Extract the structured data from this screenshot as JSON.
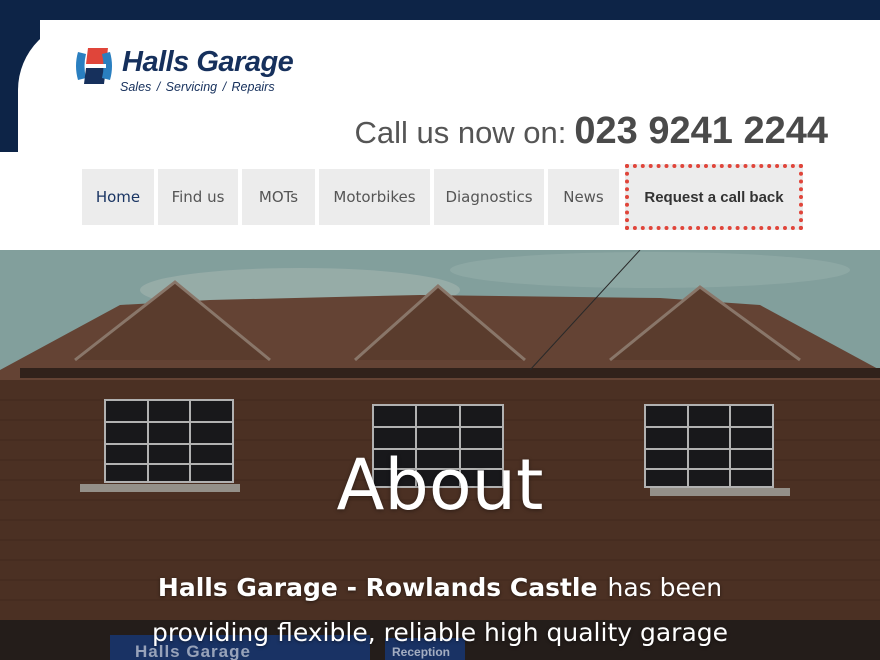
{
  "brand": {
    "name": "Halls Garage",
    "tagline": "Sales   /   Servicing   /   Repairs",
    "colors": {
      "navy": "#0d2447",
      "red": "#e0453a",
      "blue": "#2a7fc0"
    }
  },
  "header": {
    "phone_label": "Call us now on:",
    "phone_number": "023 9241 2244"
  },
  "nav": {
    "items": [
      {
        "label": "Home",
        "active": true
      },
      {
        "label": "Find us"
      },
      {
        "label": "MOTs"
      },
      {
        "label": "Motorbikes"
      },
      {
        "label": "Diagnostics"
      },
      {
        "label": "News"
      }
    ],
    "callback_label": "Request a call back"
  },
  "hero": {
    "title": "About",
    "intro_bold": "Halls Garage - Rowlands Castle",
    "intro_rest": "has been",
    "intro_line2": "providing flexible, reliable high quality garage",
    "sign_text": "Halls Garage",
    "reception_text": "Reception"
  }
}
